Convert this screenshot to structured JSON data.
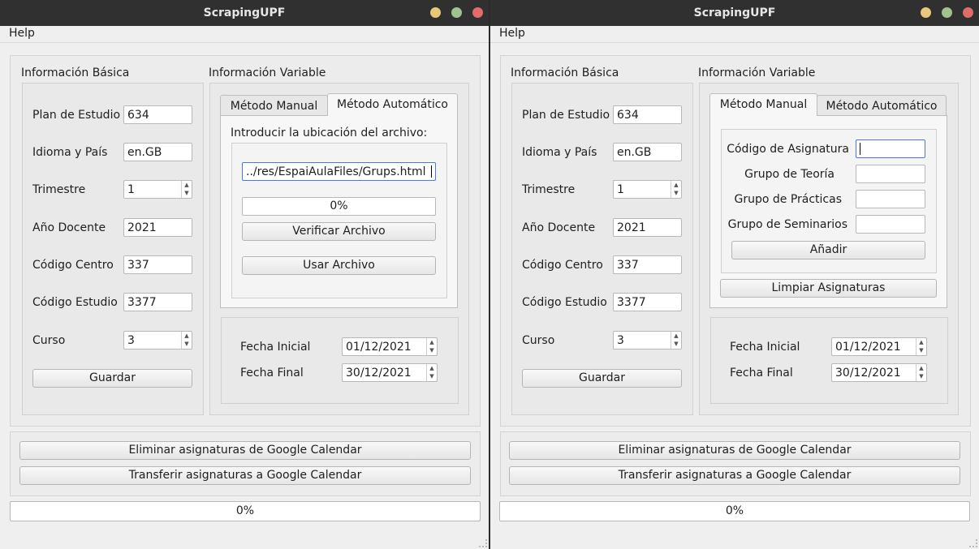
{
  "window_title": "ScrapingUPF",
  "menu": {
    "help": "Help"
  },
  "basic": {
    "title": "Información Básica",
    "plan_label": "Plan de Estudio",
    "plan_value": "634",
    "idioma_label": "Idioma y País",
    "idioma_value": "en.GB",
    "trimestre_label": "Trimestre",
    "trimestre_value": "1",
    "anio_label": "Año Docente",
    "anio_value": "2021",
    "centro_label": "Código Centro",
    "centro_value": "337",
    "estudio_label": "Código Estudio",
    "estudio_value": "3377",
    "curso_label": "Curso",
    "curso_value": "3",
    "guardar": "Guardar"
  },
  "variable": {
    "title": "Información Variable",
    "tab_manual": "Método Manual",
    "tab_auto": "Método Automático",
    "auto": {
      "prompt": "Introducir la ubicación del archivo:",
      "path": "../res/EspaiAulaFiles/Grups.html",
      "progress": "0%",
      "verificar": "Verificar Archivo",
      "usar": "Usar Archivo"
    },
    "manual": {
      "codigo_label": "Código de Asignatura",
      "codigo_value": "",
      "teoria_label": "Grupo de Teoría",
      "teoria_value": "",
      "practicas_label": "Grupo de Prácticas",
      "practicas_value": "",
      "seminarios_label": "Grupo de Seminarios",
      "seminarios_value": "",
      "anadir": "Añadir",
      "limpiar": "Limpiar Asignaturas"
    },
    "fecha_inicial_label": "Fecha Inicial",
    "fecha_inicial_value": "01/12/2021",
    "fecha_final_label": "Fecha Final",
    "fecha_final_value": "30/12/2021"
  },
  "calendar": {
    "eliminar": "Eliminar asignaturas de Google Calendar",
    "transferir": "Transferir asignaturas a Google Calendar"
  },
  "progress_bottom": "0%",
  "progress_fraction": 0,
  "colors": {
    "titlebar": "#303030",
    "minimize": "#e8c97a",
    "maximize": "#9fc28f",
    "close": "#e06c6c",
    "focus": "#4a7bd4"
  }
}
